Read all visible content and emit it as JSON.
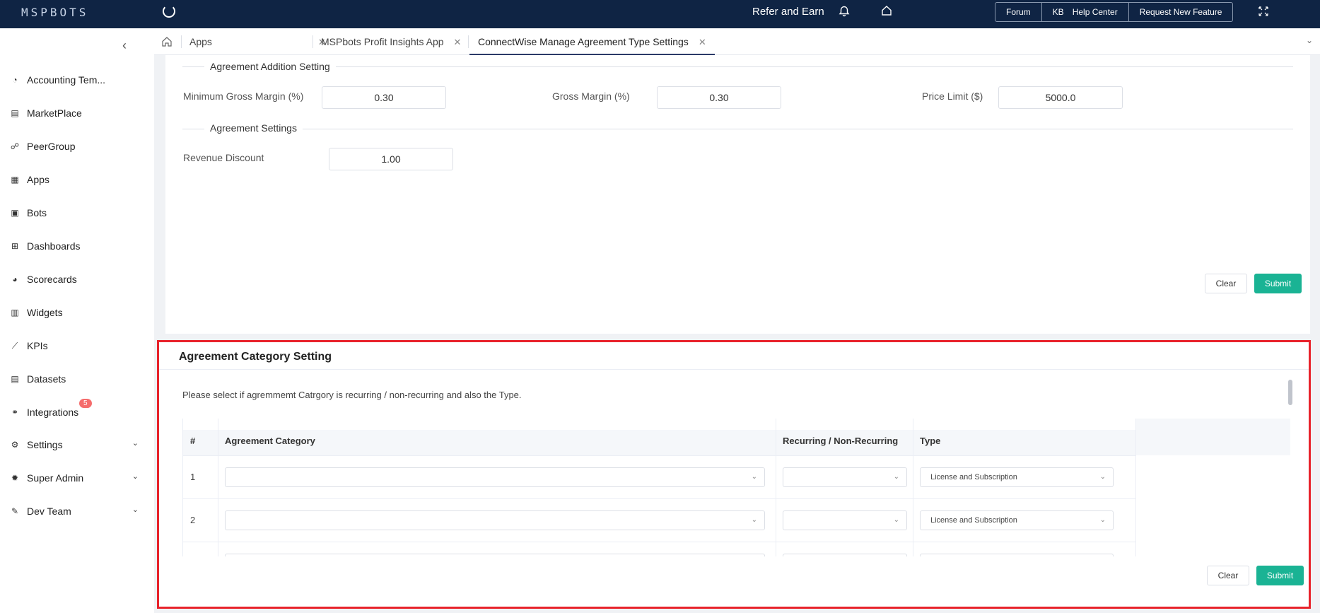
{
  "topbar": {
    "logo": "MSPBOTS",
    "refer_label": "Refer and Earn",
    "buttons": [
      "Forum",
      "KB",
      "Help Center",
      "Request New Feature"
    ]
  },
  "sidebar": {
    "items": [
      {
        "label": "Accounting Tem...",
        "icon": "gauge-icon"
      },
      {
        "label": "MarketPlace",
        "icon": "store-icon"
      },
      {
        "label": "PeerGroup",
        "icon": "people-icon"
      },
      {
        "label": "Apps",
        "icon": "grid-icon"
      },
      {
        "label": "Bots",
        "icon": "bot-icon"
      },
      {
        "label": "Dashboards",
        "icon": "table-icon"
      },
      {
        "label": "Scorecards",
        "icon": "pie-icon"
      },
      {
        "label": "Widgets",
        "icon": "widget-icon"
      },
      {
        "label": "KPIs",
        "icon": "line-chart-icon"
      },
      {
        "label": "Datasets",
        "icon": "dataset-icon"
      },
      {
        "label": "Integrations",
        "icon": "link-icon"
      },
      {
        "label": "Settings",
        "icon": "gear-icon"
      },
      {
        "label": "Super Admin",
        "icon": "admin-gear-icon"
      },
      {
        "label": "Dev Team",
        "icon": "wrench-icon"
      }
    ],
    "integrations_badge": "5"
  },
  "tabs": [
    {
      "label": "Apps"
    },
    {
      "label": "MSPbots Profit Insights App"
    },
    {
      "label": "ConnectWise Manage Agreement Type Settings"
    }
  ],
  "upper": {
    "section1_title": "Agreement Addition Setting",
    "min_gross_margin_label": "Minimum Gross Margin (%)",
    "min_gross_margin_value": "0.30",
    "gross_margin_label": "Gross Margin (%)",
    "gross_margin_value": "0.30",
    "price_limit_label": "Price Limit ($)",
    "price_limit_value": "5000.0",
    "section2_title": "Agreement Settings",
    "revenue_discount_label": "Revenue Discount",
    "revenue_discount_value": "1.00",
    "clear_label": "Clear",
    "submit_label": "Submit"
  },
  "lower": {
    "title": "Agreement Category Setting",
    "description": "Please select if agremmemt Catrgory is recurring / non-recurring and also the Type.",
    "columns": [
      "#",
      "Agreement Category",
      "Recurring / Non-Recurring",
      "Type"
    ],
    "rows": [
      {
        "num": "1",
        "category": "",
        "recurring": "",
        "type": "License and Subscription"
      },
      {
        "num": "2",
        "category": "",
        "recurring": "",
        "type": "License and Subscription"
      }
    ],
    "clear_label": "Clear",
    "submit_label": "Submit"
  },
  "colors": {
    "topbar": "#0f2444",
    "submit": "#1ab394",
    "highlight_border": "#e8232b",
    "badge": "#f56c6c"
  }
}
